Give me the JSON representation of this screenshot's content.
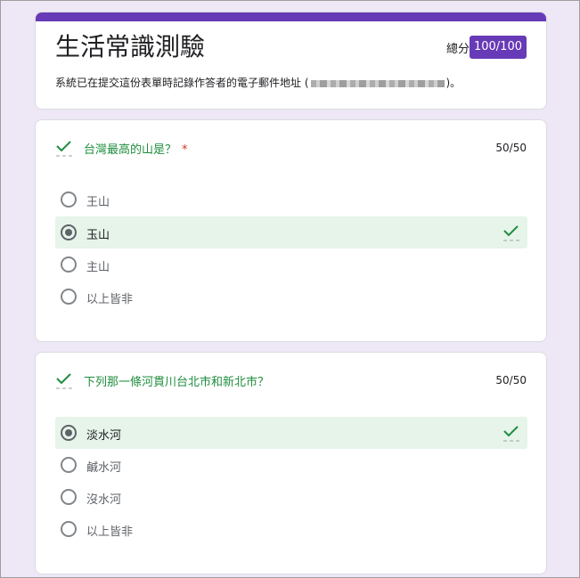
{
  "form": {
    "title": "生活常識測驗",
    "score_label": "總分",
    "score_value": "100/100",
    "email_note_prefix": "系統已在提交這份表單時記錄作答者的電子郵件地址 (",
    "email_note_suffix": ")。"
  },
  "questions": [
    {
      "title": "台灣最高的山是？",
      "required_mark": "*",
      "points": "50/50",
      "options": [
        {
          "label": "王山"
        },
        {
          "label": "玉山"
        },
        {
          "label": "主山"
        },
        {
          "label": "以上皆非"
        }
      ]
    },
    {
      "title": "下列那一條河貫川台北市和新北市？",
      "points": "50/50",
      "options": [
        {
          "label": "淡水河"
        },
        {
          "label": "鹹水河"
        },
        {
          "label": "沒水河"
        },
        {
          "label": "以上皆非"
        }
      ]
    }
  ],
  "colors": {
    "accent": "#673ab7",
    "correct_green": "#1e8e3e",
    "correct_bg": "#e6f4ea",
    "required_red": "#d93025",
    "page_bg": "#ede7f6"
  },
  "icons": {
    "correct": "check-icon",
    "selected": "radio-checked-icon",
    "unselected": "radio-unchecked-icon"
  }
}
